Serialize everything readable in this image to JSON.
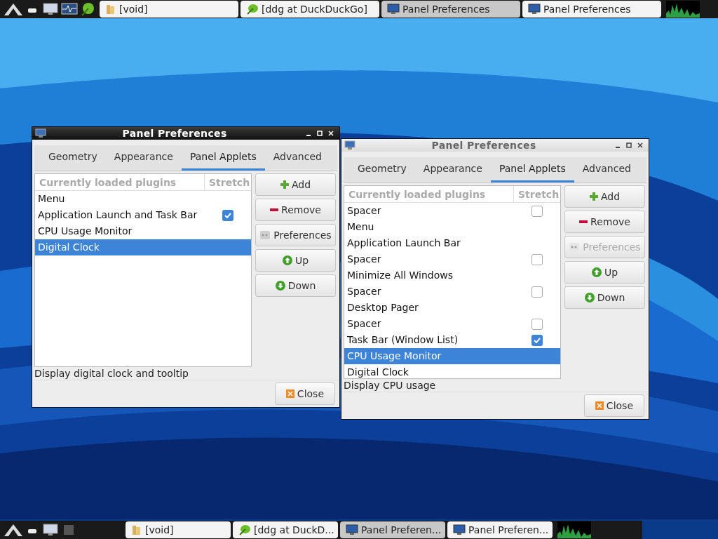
{
  "top_panel": {
    "tasks": [
      {
        "title": "[void]",
        "kind": "folder",
        "selected": false
      },
      {
        "title": "[ddg at DuckDuckGo]",
        "kind": "leaf",
        "selected": false
      },
      {
        "title": "Panel Preferences",
        "kind": "monitor",
        "selected": true
      },
      {
        "title": "Panel Preferences",
        "kind": "monitor",
        "selected": false
      }
    ]
  },
  "windows": [
    {
      "title": "Panel Preferences",
      "active": true,
      "tabs": [
        {
          "label": "Geometry",
          "selected": false
        },
        {
          "label": "Appearance",
          "selected": false
        },
        {
          "label": "Panel Applets",
          "selected": true
        },
        {
          "label": "Advanced",
          "selected": false
        }
      ],
      "columns": [
        "Currently loaded plugins",
        "Stretch"
      ],
      "plugins": [
        {
          "name": "Menu",
          "kind": "fixed",
          "selected": false
        },
        {
          "name": "Application Launch and Task Bar",
          "kind": "stretchable",
          "checked": true,
          "selected": false
        },
        {
          "name": "CPU Usage Monitor",
          "kind": "fixed",
          "selected": false
        },
        {
          "name": "Digital Clock",
          "kind": "fixed",
          "selected": true
        }
      ],
      "buttons": [
        {
          "label": "Add",
          "kind": "add",
          "disabled": false
        },
        {
          "label": "Remove",
          "kind": "remove",
          "disabled": false
        },
        {
          "label": "Preferences",
          "kind": "preferences",
          "disabled": false
        },
        {
          "label": "Up",
          "kind": "up",
          "disabled": false
        },
        {
          "label": "Down",
          "kind": "down",
          "disabled": false
        }
      ],
      "description": "Display digital clock and tooltip",
      "close_button": "Close"
    },
    {
      "title": "Panel Preferences",
      "active": false,
      "tabs": [
        {
          "label": "Geometry",
          "selected": false
        },
        {
          "label": "Appearance",
          "selected": false
        },
        {
          "label": "Panel Applets",
          "selected": true
        },
        {
          "label": "Advanced",
          "selected": false
        }
      ],
      "columns": [
        "Currently loaded plugins",
        "Stretch"
      ],
      "plugins": [
        {
          "name": "Spacer",
          "kind": "stretchable",
          "checked": false,
          "selected": false
        },
        {
          "name": "Menu",
          "kind": "fixed",
          "selected": false
        },
        {
          "name": "Application Launch Bar",
          "kind": "fixed",
          "selected": false
        },
        {
          "name": "Spacer",
          "kind": "stretchable",
          "checked": false,
          "selected": false
        },
        {
          "name": "Minimize All Windows",
          "kind": "fixed",
          "selected": false
        },
        {
          "name": "Spacer",
          "kind": "stretchable",
          "checked": false,
          "selected": false
        },
        {
          "name": "Desktop Pager",
          "kind": "fixed",
          "selected": false
        },
        {
          "name": "Spacer",
          "kind": "stretchable",
          "checked": false,
          "selected": false
        },
        {
          "name": "Task Bar (Window List)",
          "kind": "stretchable",
          "checked": true,
          "selected": false
        },
        {
          "name": "CPU Usage Monitor",
          "kind": "fixed",
          "selected": true
        },
        {
          "name": "Digital Clock",
          "kind": "fixed",
          "selected": false
        }
      ],
      "buttons": [
        {
          "label": "Add",
          "kind": "add",
          "disabled": false
        },
        {
          "label": "Remove",
          "kind": "remove",
          "disabled": false
        },
        {
          "label": "Preferences",
          "kind": "preferences",
          "disabled": true
        },
        {
          "label": "Up",
          "kind": "up",
          "disabled": false
        },
        {
          "label": "Down",
          "kind": "down",
          "disabled": false
        }
      ],
      "description": "Display CPU usage",
      "close_button": "Close"
    }
  ],
  "bottom_panel": {
    "tasks": [
      {
        "title": "[void]",
        "kind": "folder",
        "selected": false
      },
      {
        "title": "[ddg at DuckD...",
        "kind": "leaf",
        "selected": false
      },
      {
        "title": "Panel Preferen...",
        "kind": "monitor",
        "selected": true
      },
      {
        "title": "Panel Preferen...",
        "kind": "monitor",
        "selected": false
      }
    ]
  }
}
